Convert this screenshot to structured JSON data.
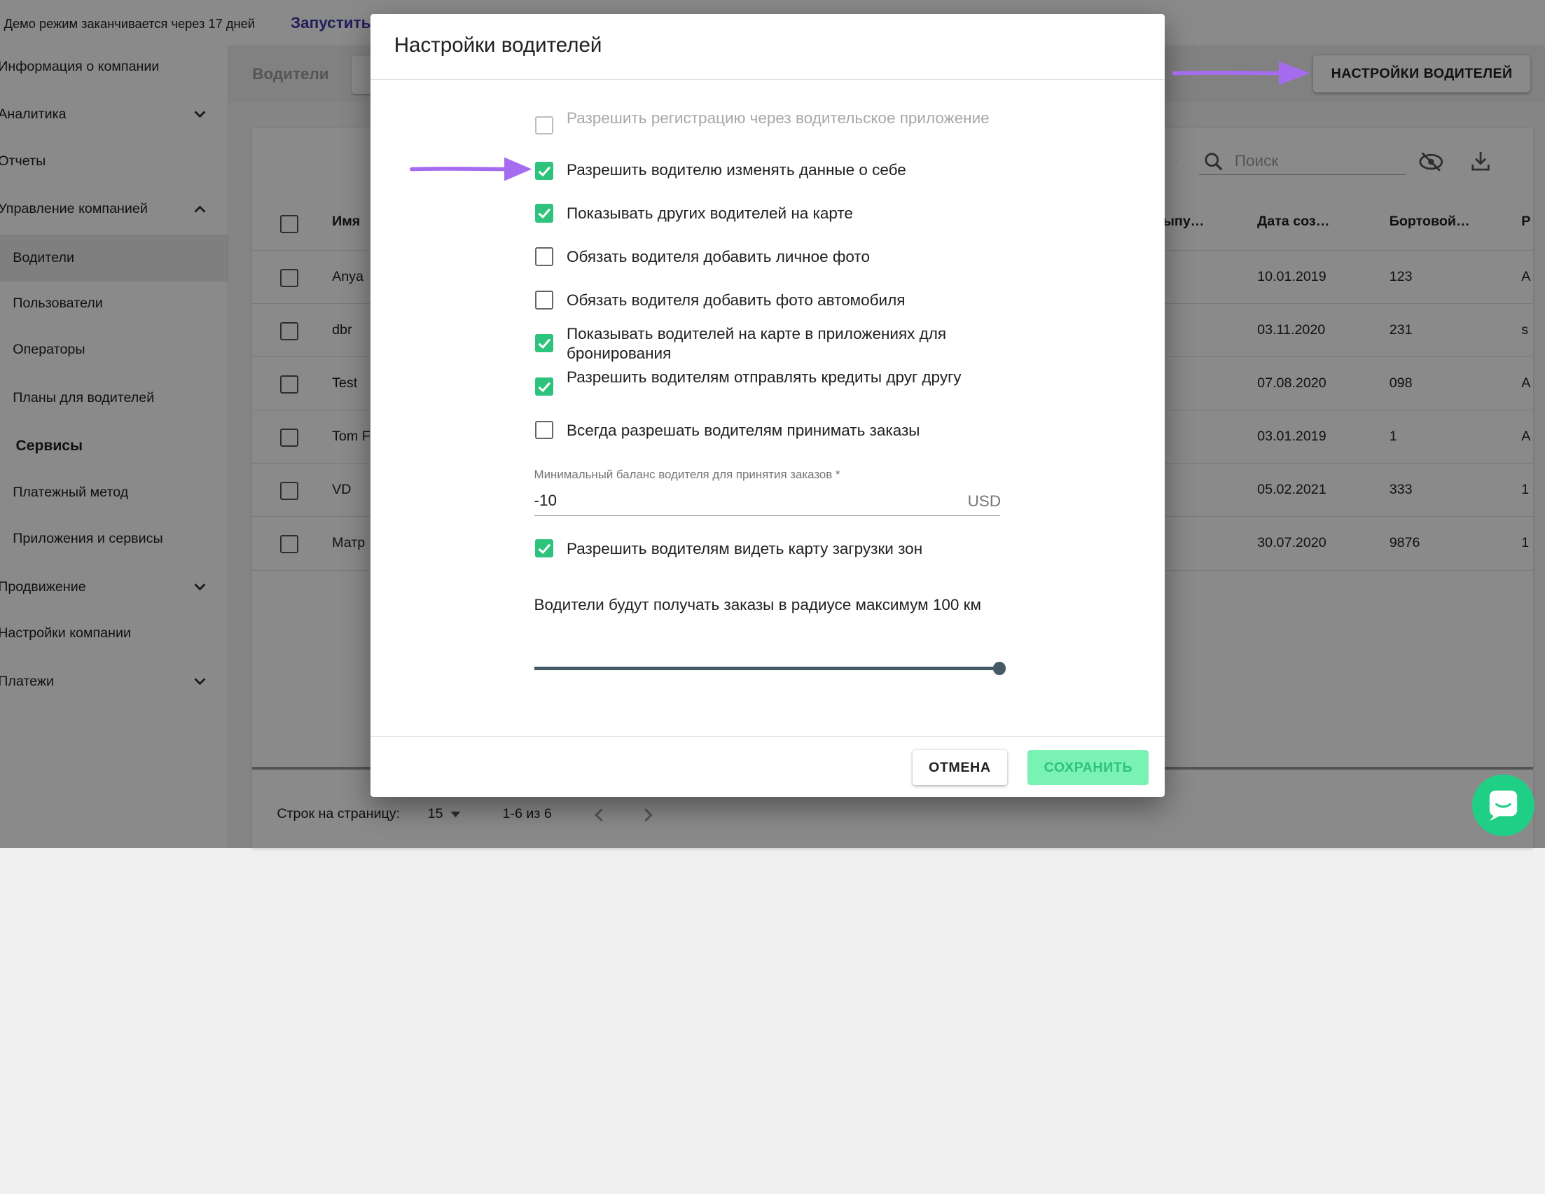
{
  "topbar": {
    "demo_text": "Демо режим заканчивается через 17 дней",
    "launch_label": "Запустить"
  },
  "sidebar": {
    "items": [
      {
        "label": "Информация о компании"
      },
      {
        "label": "Аналитика"
      },
      {
        "label": "Отчеты"
      },
      {
        "label": "Управление компанией"
      },
      {
        "label": "Водители"
      },
      {
        "label": "Пользователи"
      },
      {
        "label": "Операторы"
      },
      {
        "label": "Планы для водителей"
      },
      {
        "label": "Сервисы"
      },
      {
        "label": "Платежный метод"
      },
      {
        "label": "Приложения и сервисы"
      },
      {
        "label": "Продвижение"
      },
      {
        "label": "Настройки компании"
      },
      {
        "label": "Платежи"
      }
    ]
  },
  "content": {
    "header_title": "Водители",
    "settings_button": "НАСТРОЙКИ ВОДИТЕЛЕЙ",
    "search_placeholder": "Поиск",
    "columns": [
      "Имя",
      "ыпу…",
      "Дата соз…",
      "Бортовой…",
      "Р"
    ],
    "rows": [
      {
        "name": "Anya",
        "date": "10.01.2019",
        "board": "123",
        "extra": "A"
      },
      {
        "name": "dbr",
        "date": "03.11.2020",
        "board": "231",
        "extra": "s"
      },
      {
        "name": "Test",
        "date": "07.08.2020",
        "board": "098",
        "extra": "A"
      },
      {
        "name": "Tom F",
        "date": "03.01.2019",
        "board": "1",
        "extra": "A"
      },
      {
        "name": "VD",
        "date": "05.02.2021",
        "board": "333",
        "extra": "1"
      },
      {
        "name": "Матр",
        "date": "30.07.2020",
        "board": "9876",
        "extra": "1"
      }
    ],
    "footer": {
      "rows_per_page_label": "Строк на страницу:",
      "rows_per_page_value": "15",
      "range": "1-6 из 6"
    }
  },
  "dialog": {
    "title": "Настройки водителей",
    "options": [
      {
        "label": "Разрешить регистрацию через водительское приложение",
        "checked": false,
        "disabled": true
      },
      {
        "label": "Разрешить водителю изменять данные о себе",
        "checked": true,
        "disabled": false
      },
      {
        "label": "Показывать других водителей на карте",
        "checked": true,
        "disabled": false
      },
      {
        "label": "Обязать водителя добавить личное фото",
        "checked": false,
        "disabled": false
      },
      {
        "label": "Обязать водителя добавить фото автомобиля",
        "checked": false,
        "disabled": false
      },
      {
        "label": "Показывать водителей на карте в приложениях для бронирования",
        "checked": true,
        "disabled": false
      },
      {
        "label": "Разрешить водителям отправлять кредиты друг другу",
        "checked": true,
        "disabled": false
      },
      {
        "label": "Всегда разрешать водителям принимать заказы",
        "checked": false,
        "disabled": false
      }
    ],
    "min_balance": {
      "label": "Минимальный баланс водителя для принятия заказов *",
      "value": "-10",
      "unit": "USD"
    },
    "zones_option": {
      "label": "Разрешить водителям видеть карту загрузки зон",
      "checked": true
    },
    "radius_text": "Водители будут получать заказы в радиусе максимум 100 км",
    "slider_level": 1.0,
    "cancel_label": "ОТМЕНА",
    "save_label": "СОХРАНИТЬ"
  },
  "colors": {
    "accent_green": "#2ec37c",
    "save_bg": "#79f2b3",
    "arrow_purple": "#a66cf0",
    "link_blue": "#3f3aa8",
    "chat_green": "#1fcf85"
  },
  "icons": [
    "chevron-down-icon",
    "chevron-up-icon",
    "search-icon",
    "visibility-off-icon",
    "download-icon",
    "check-icon",
    "chat-icon",
    "arrow-pointer-icon"
  ]
}
